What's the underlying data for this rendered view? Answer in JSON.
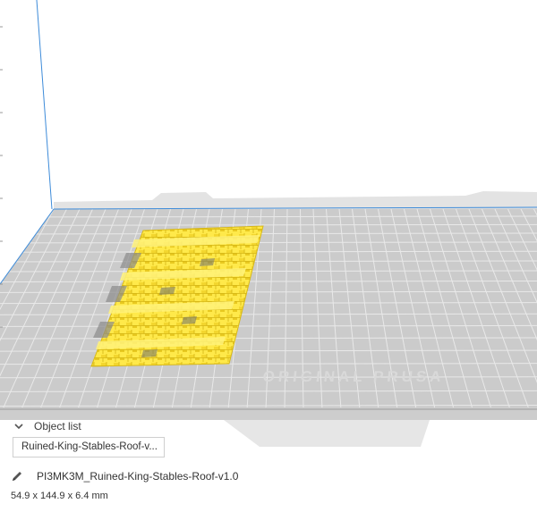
{
  "object_list": {
    "header_label": "Object list",
    "items": [
      "Ruined-King-Stables-Roof-v..."
    ]
  },
  "object_details": {
    "name": "PI3MK3M_Ruined-King-Stables-Roof-v1.0",
    "dimensions": "54.9 x 144.9 x 6.4 mm"
  },
  "build_plate": {
    "watermark": "ORIGINAL PRUSA"
  },
  "icons": {
    "chevron": "chevron-down-icon",
    "pencil": "pencil-icon"
  },
  "colors": {
    "model": "#ffea4a",
    "plate": "#c9c9c9",
    "grid": "#e7e7e7",
    "axis_blue": "#3d8bd9"
  }
}
